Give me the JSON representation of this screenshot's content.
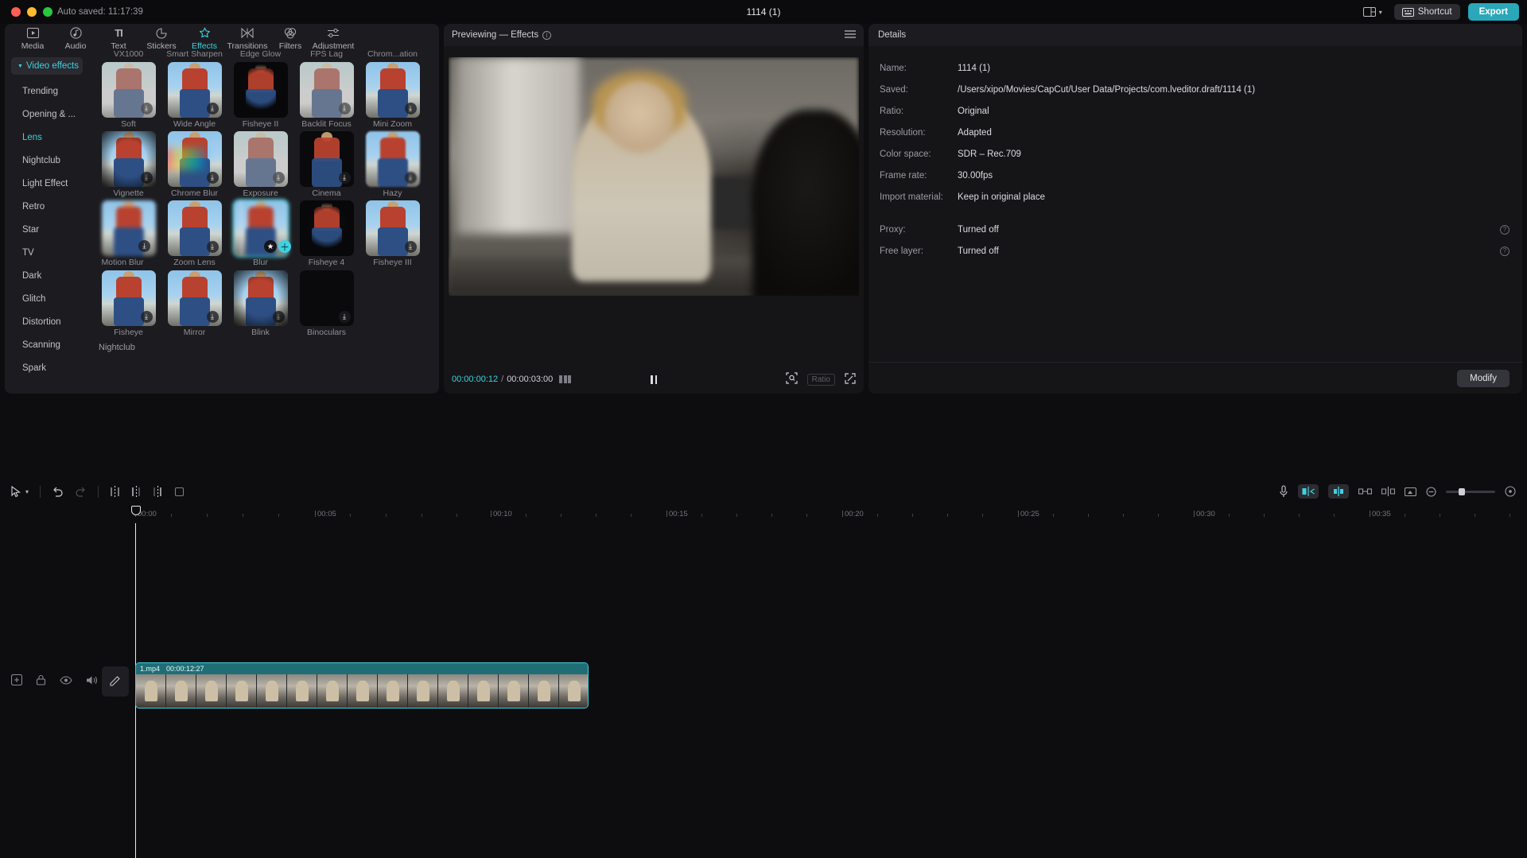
{
  "titlebar": {
    "autosave": "Auto saved: 11:17:39",
    "window_title": "1114 (1)",
    "shortcut_label": "Shortcut",
    "export_label": "Export",
    "layout_icon": "layout-grid-icon",
    "keyboard_icon": "keyboard-icon",
    "chevron_icon": "chevron-down-icon"
  },
  "toptabs": [
    {
      "label": "Media",
      "icon": "media-icon",
      "glyph": "▶",
      "active": false
    },
    {
      "label": "Audio",
      "icon": "audio-icon",
      "glyph": "♪",
      "active": false
    },
    {
      "label": "Text",
      "icon": "text-icon",
      "glyph": "TI",
      "active": false
    },
    {
      "label": "Stickers",
      "icon": "stickers-icon",
      "glyph": "◐",
      "active": false
    },
    {
      "label": "Effects",
      "icon": "effects-icon",
      "glyph": "✦",
      "active": true
    },
    {
      "label": "Transitions",
      "icon": "transitions-icon",
      "glyph": "⋈",
      "active": false
    },
    {
      "label": "Filters",
      "icon": "filters-icon",
      "glyph": "◓",
      "active": false
    },
    {
      "label": "Adjustment",
      "icon": "adjustment-icon",
      "glyph": "≡",
      "active": false
    }
  ],
  "categories": [
    {
      "label": "Video effects",
      "group": true,
      "active": true
    },
    {
      "label": "Trending",
      "group": false,
      "active": false
    },
    {
      "label": "Opening & ...",
      "group": false,
      "active": false
    },
    {
      "label": "Lens",
      "group": false,
      "active": true
    },
    {
      "label": "Nightclub",
      "group": false,
      "active": false
    },
    {
      "label": "Light Effect",
      "group": false,
      "active": false
    },
    {
      "label": "Retro",
      "group": false,
      "active": false
    },
    {
      "label": "Star",
      "group": false,
      "active": false
    },
    {
      "label": "TV",
      "group": false,
      "active": false
    },
    {
      "label": "Dark",
      "group": false,
      "active": false
    },
    {
      "label": "Glitch",
      "group": false,
      "active": false
    },
    {
      "label": "Distortion",
      "group": false,
      "active": false
    },
    {
      "label": "Scanning",
      "group": false,
      "active": false
    },
    {
      "label": "Spark",
      "group": false,
      "active": false
    }
  ],
  "partial_top_labels": [
    "VX1000",
    "Smart Sharpen",
    "Edge Glow",
    "FPS Lag",
    "Chrom...ation"
  ],
  "effects_rows": [
    [
      {
        "label": "Soft",
        "style": "faded",
        "download": true,
        "selected": false
      },
      {
        "label": "Wide Angle",
        "style": "normal",
        "download": true,
        "selected": false
      },
      {
        "label": "Fisheye II",
        "style": "circle",
        "download": true,
        "selected": false
      },
      {
        "label": "Backlit Focus",
        "style": "faded",
        "download": true,
        "selected": false
      },
      {
        "label": "Mini Zoom",
        "style": "normal",
        "download": true,
        "selected": false
      }
    ],
    [
      {
        "label": "Vignette",
        "style": "vign",
        "download": true,
        "selected": false
      },
      {
        "label": "Chrome Blur",
        "style": "chrome",
        "download": true,
        "selected": false
      },
      {
        "label": "Exposure",
        "style": "faded",
        "download": true,
        "selected": false
      },
      {
        "label": "Cinema",
        "style": "dark",
        "download": true,
        "selected": false
      },
      {
        "label": "Hazy",
        "style": "blurs",
        "download": true,
        "selected": false
      }
    ],
    [
      {
        "label": "Motion Blur",
        "style": "blurd",
        "download": true,
        "selected": false
      },
      {
        "label": "Zoom Lens",
        "style": "normal",
        "download": true,
        "selected": false
      },
      {
        "label": "Blur",
        "style": "blurd",
        "download": false,
        "selected": true
      },
      {
        "label": "Fisheye 4",
        "style": "circle",
        "download": true,
        "selected": false
      },
      {
        "label": "Fisheye III",
        "style": "normal",
        "download": true,
        "selected": false
      }
    ],
    [
      {
        "label": "Fisheye",
        "style": "normal",
        "download": true,
        "selected": false
      },
      {
        "label": "Mirror",
        "style": "normal",
        "download": true,
        "selected": false
      },
      {
        "label": "Blink",
        "style": "vign",
        "download": true,
        "selected": false
      },
      {
        "label": "Binoculars",
        "style": "blank",
        "download": true,
        "selected": false
      },
      {
        "label": "",
        "style": "hidden",
        "download": false,
        "selected": false
      }
    ]
  ],
  "section_footer_label": "Nightclub",
  "overlay_icons": {
    "favorite": "star-icon",
    "add": "plus-icon",
    "download": "download-icon"
  },
  "preview": {
    "title": "Previewing — Effects",
    "info_icon": "info-icon",
    "menu_icon": "hamburger-menu-icon",
    "current_time": "00:00:00:12",
    "total_time": "00:00:03:00",
    "separator": "/",
    "list_icon": "list-view-icon",
    "pause_icon": "pause-icon",
    "crop_icon": "crop-icon",
    "ratio_label": "Ratio",
    "fullscreen_icon": "fullscreen-icon"
  },
  "details": {
    "title": "Details",
    "rows": [
      {
        "key": "Name:",
        "value": "1114 (1)",
        "help": false
      },
      {
        "key": "Saved:",
        "value": "/Users/xipo/Movies/CapCut/User Data/Projects/com.lveditor.draft/1114 (1)",
        "help": false
      },
      {
        "key": "Ratio:",
        "value": "Original",
        "help": false
      },
      {
        "key": "Resolution:",
        "value": "Adapted",
        "help": false
      },
      {
        "key": "Color space:",
        "value": "SDR – Rec.709",
        "help": false
      },
      {
        "key": "Frame rate:",
        "value": "30.00fps",
        "help": false
      },
      {
        "key": "Import material:",
        "value": "Keep in original place",
        "help": false
      }
    ],
    "rows2": [
      {
        "key": "Proxy:",
        "value": "Turned off",
        "help": true
      },
      {
        "key": "Free layer:",
        "value": "Turned off",
        "help": true
      }
    ],
    "modify_label": "Modify"
  },
  "timeline": {
    "toolbar_left": [
      {
        "icon": "select-tool-icon",
        "glyph": "⬉"
      },
      {
        "icon": "chevron-down-icon",
        "glyph": "⌄"
      },
      {
        "icon": "undo-icon",
        "glyph": "↺"
      },
      {
        "icon": "redo-icon",
        "glyph": "↻"
      },
      {
        "icon": "split-icon",
        "glyph": "⌶"
      },
      {
        "icon": "trim-left-icon",
        "glyph": "⌷"
      },
      {
        "icon": "trim-right-icon",
        "glyph": "⌸"
      },
      {
        "icon": "crop-clip-icon",
        "glyph": "▫"
      }
    ],
    "toolbar_right": [
      {
        "icon": "microphone-icon",
        "glyph": "🎙",
        "active": false,
        "boxed": false
      },
      {
        "icon": "mirror-icon",
        "glyph": "⇥",
        "active": true,
        "boxed": true
      },
      {
        "icon": "magnet-snap-icon",
        "glyph": "⚏",
        "active": true,
        "boxed": true
      },
      {
        "icon": "link-icon",
        "glyph": "⇹",
        "active": false,
        "boxed": false
      },
      {
        "icon": "center-align-icon",
        "glyph": "⊣⊢",
        "active": false,
        "boxed": false
      },
      {
        "icon": "keyframe-icon",
        "glyph": "⬓",
        "active": false,
        "boxed": false
      },
      {
        "icon": "zoom-out-icon",
        "glyph": "⊖",
        "active": false,
        "boxed": false
      },
      {
        "icon": "fit-timeline-icon",
        "glyph": "⊙",
        "active": false,
        "boxed": false
      }
    ],
    "ruler_labels": [
      "00:00",
      "00:05",
      "00:10",
      "00:15",
      "00:20",
      "00:25",
      "00:30",
      "00:35"
    ],
    "track_tools": [
      {
        "icon": "add-track-icon",
        "glyph": "⊞"
      },
      {
        "icon": "lock-icon",
        "glyph": "🔒"
      },
      {
        "icon": "eye-icon",
        "glyph": "👁"
      },
      {
        "icon": "volume-icon",
        "glyph": "🔊"
      }
    ],
    "edit_icon": "pencil-edit-icon",
    "clip": {
      "name": "1.mp4",
      "duration": "00:00:12:27"
    }
  },
  "colors": {
    "accent": "#3dd2e0",
    "export": "#2aa7b8",
    "panel": "#1c1c20",
    "bg": "#0d0d0f"
  }
}
